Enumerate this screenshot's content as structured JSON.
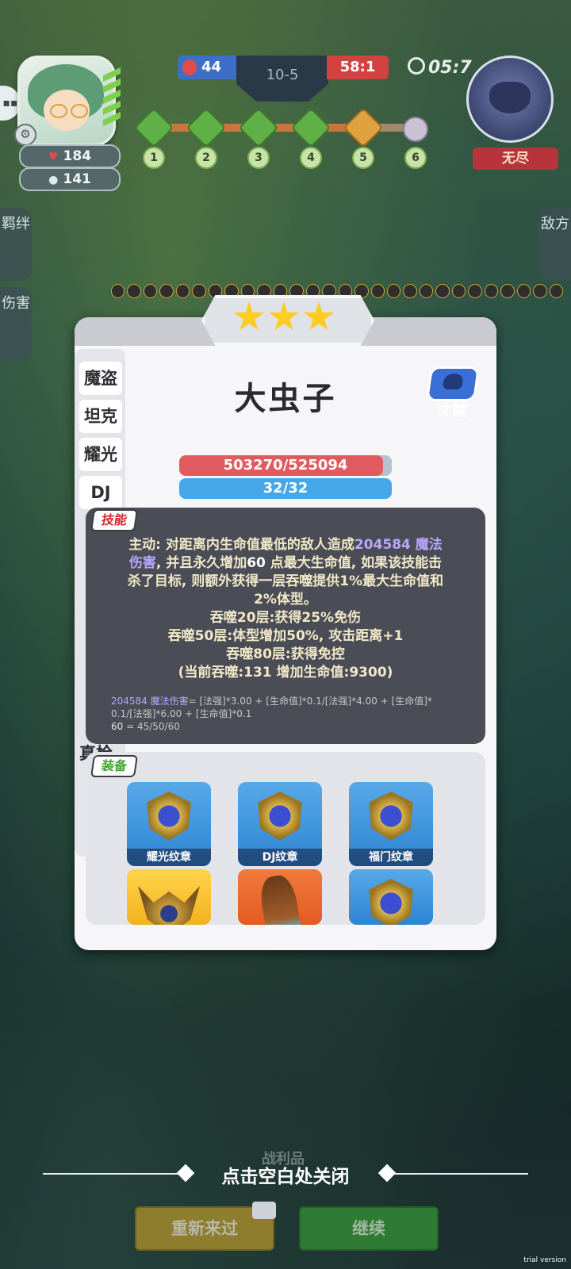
{
  "hud": {
    "hero_hp": "184",
    "hero_coins": "141",
    "blue_score": "44",
    "round": "10-5",
    "red_score": "58:1",
    "timer": "05:7",
    "enemy_label": "无尽",
    "stages": [
      "1",
      "2",
      "3",
      "4",
      "5",
      "6"
    ],
    "left_tabs": [
      "羁绊",
      "伤害"
    ],
    "right_tab": "敌方"
  },
  "panel": {
    "stars": 3,
    "races": [
      "魔盗",
      "坦克",
      "耀光",
      "DJ"
    ],
    "race_hidden": "真枪",
    "unit_name": "大虫子",
    "guide_label": "攻略",
    "hp_text": "503270/525094",
    "hp_fraction": 0.958,
    "mp_text": "32/32",
    "skill_tag": "技能",
    "skill": {
      "l1a": "主动: 对距离内生命值最低的敌人造成",
      "l1b": "204584 魔法",
      "l2a": "伤害",
      "l2b": ", 并且永久增加",
      "l2c": "60",
      "l2d": " 点最大生命值, 如果该技能击",
      "l3": "杀了目标, 则额外获得一层吞噬提供1%最大生命值和",
      "l4": "2%体型。",
      "l5": "吞噬20层:获得25%免伤",
      "l6": "吞噬50层:体型增加50%, 攻击距离+1",
      "l7": "吞噬80层:获得免控",
      "l8": "(当前吞噬:131 增加生命值:9300)"
    },
    "formula": {
      "f1a": "204584 魔法伤害",
      "f1b": "= [法强]*3.00 + [生命值]*0.1/[法强]*4.00 + [生命值]*",
      "f2": "0.1/[法强]*6.00 + [生命值]*0.1",
      "f3a": "60",
      "f3b": " = 45/50/60"
    },
    "equip_tag": "装备",
    "equipment": [
      "耀光纹章",
      "DJ纹章",
      "福门纹章"
    ]
  },
  "footer": {
    "close_hint": "点击空白处关闭",
    "loot_label": "战利品",
    "retry": "重新来过",
    "continue": "继续",
    "trial": "trial version"
  },
  "colors": {
    "hp": "#e15a5f",
    "mp": "#46a7e8",
    "skill_highlight": "#b9a6ff",
    "star": "#ffcc22"
  }
}
